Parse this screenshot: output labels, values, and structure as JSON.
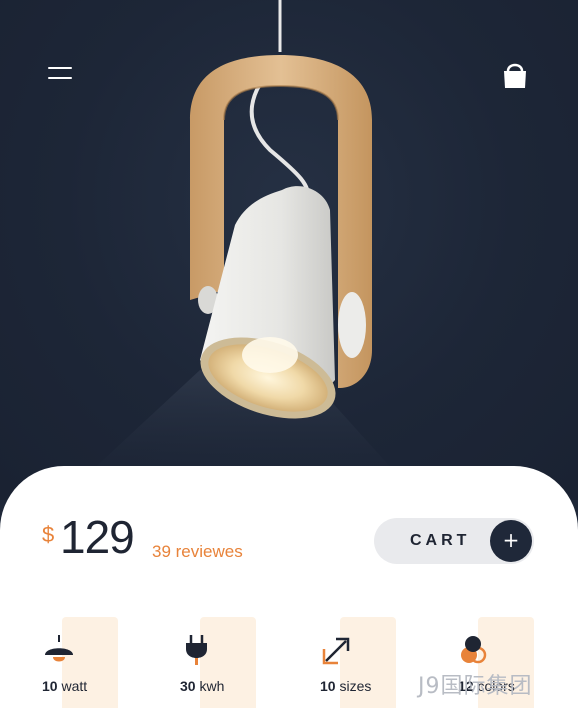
{
  "header": {
    "menu_icon": "hamburger-menu-icon",
    "bag_icon": "shopping-bag-icon"
  },
  "product": {
    "currency": "$",
    "price": "129",
    "reviews": "39 reviewes"
  },
  "cart": {
    "label": "CART",
    "plus": "+"
  },
  "specs": [
    {
      "icon": "lamp-shade-icon",
      "value": "10",
      "unit": "watt"
    },
    {
      "icon": "power-plug-icon",
      "value": "30",
      "unit": "kwh"
    },
    {
      "icon": "resize-arrows-icon",
      "value": "10",
      "unit": "sizes"
    },
    {
      "icon": "color-swatch-icon",
      "value": "12",
      "unit": "colors"
    }
  ],
  "watermark": "J9国际集团",
  "colors": {
    "hero_background": "#1f2839",
    "accent": "#e8833a",
    "text_dark": "#1f2533",
    "tile": "#fdf1e3"
  }
}
